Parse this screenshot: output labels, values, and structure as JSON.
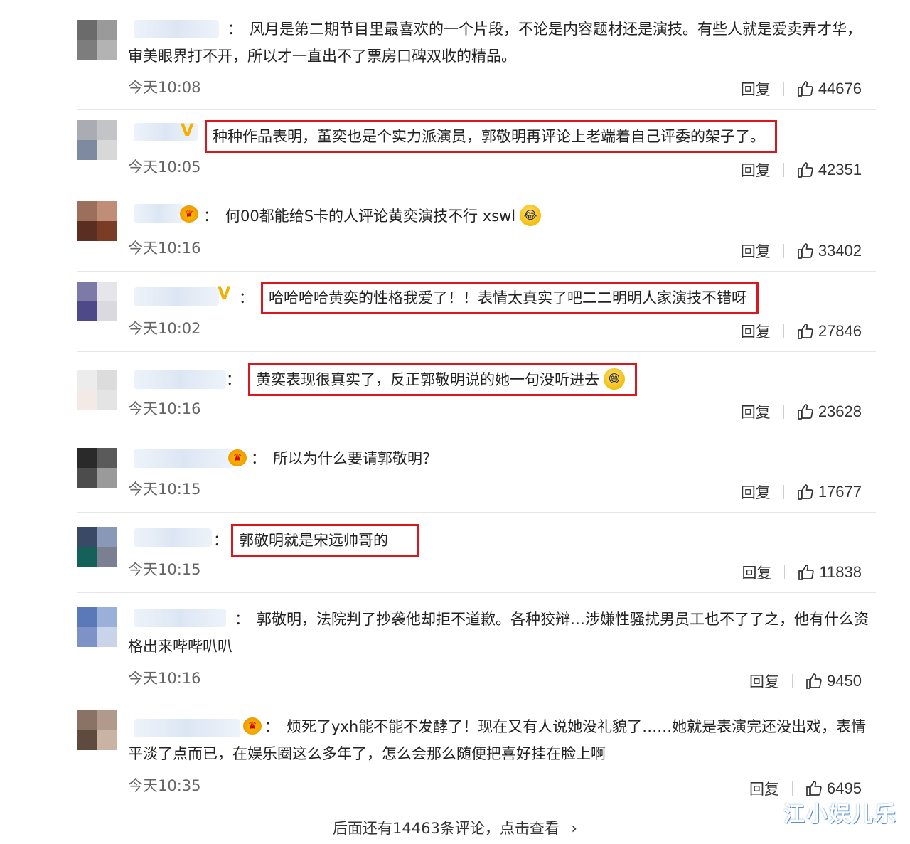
{
  "comments": [
    {
      "text": "风月是第二期节目里最喜欢的一个片段，不论是内容题材还是演技。有些人就是爱卖弄才华，审美眼界打不开，所以才一直出不了票房口碑双收的精品。",
      "time": "今天10:08",
      "reply": "回复",
      "likes": "44676",
      "badge": "",
      "highlighted": false
    },
    {
      "text": "种种作品表明，董奕也是个实力派演员，郭敬明再评论上老端着自己评委的架子了。",
      "time": "今天10:05",
      "reply": "回复",
      "likes": "42351",
      "badge": "v",
      "highlighted": true
    },
    {
      "text": "何00都能给S卡的人评论黄奕演技不行 xswl",
      "time": "今天10:16",
      "reply": "回复",
      "likes": "33402",
      "badge": "crown",
      "highlighted": false
    },
    {
      "text": "哈哈哈哈黄奕的性格我爱了！！表情太真实了吧二二明明人家演技不错呀",
      "time": "今天10:02",
      "reply": "回复",
      "likes": "27846",
      "badge": "v",
      "highlighted": true
    },
    {
      "text": "黄奕表现很真实了，反正郭敬明说的她一句没听进去",
      "time": "今天10:16",
      "reply": "回复",
      "likes": "23628",
      "badge": "",
      "highlighted": true
    },
    {
      "text": "所以为什么要请郭敬明？",
      "time": "今天10:15",
      "reply": "回复",
      "likes": "17677",
      "badge": "crown",
      "highlighted": false
    },
    {
      "text": "郭敬明就是宋远帅哥的",
      "time": "今天10:15",
      "reply": "回复",
      "likes": "11838",
      "badge": "",
      "highlighted": true
    },
    {
      "text": "郭敬明，法院判了抄袭他却拒不道歉。各种狡辩…涉嫌性骚扰男员工也不了了之，他有什么资格出来哔哔叭叭",
      "time": "今天10:16",
      "reply": "回复",
      "likes": "9450",
      "badge": "",
      "highlighted": false
    },
    {
      "text": "烦死了yxh能不能不发酵了！现在又有人说她没礼貌了……她就是表演完还没出戏，表情平淡了点而已，在娱乐圈这么多年了，怎么会那么随便把喜好挂在脸上啊",
      "time": "今天10:35",
      "reply": "回复",
      "likes": "6495",
      "badge": "crown",
      "highlighted": false
    }
  ],
  "footer": {
    "more_label": "后面还有14463条评论，点击查看",
    "chevron": "›"
  },
  "watermark": "江小娱儿乐",
  "colors": {
    "highlight_border": "#d8181e",
    "v_badge": "#f2b100",
    "crown_badge": "#f09a00"
  }
}
